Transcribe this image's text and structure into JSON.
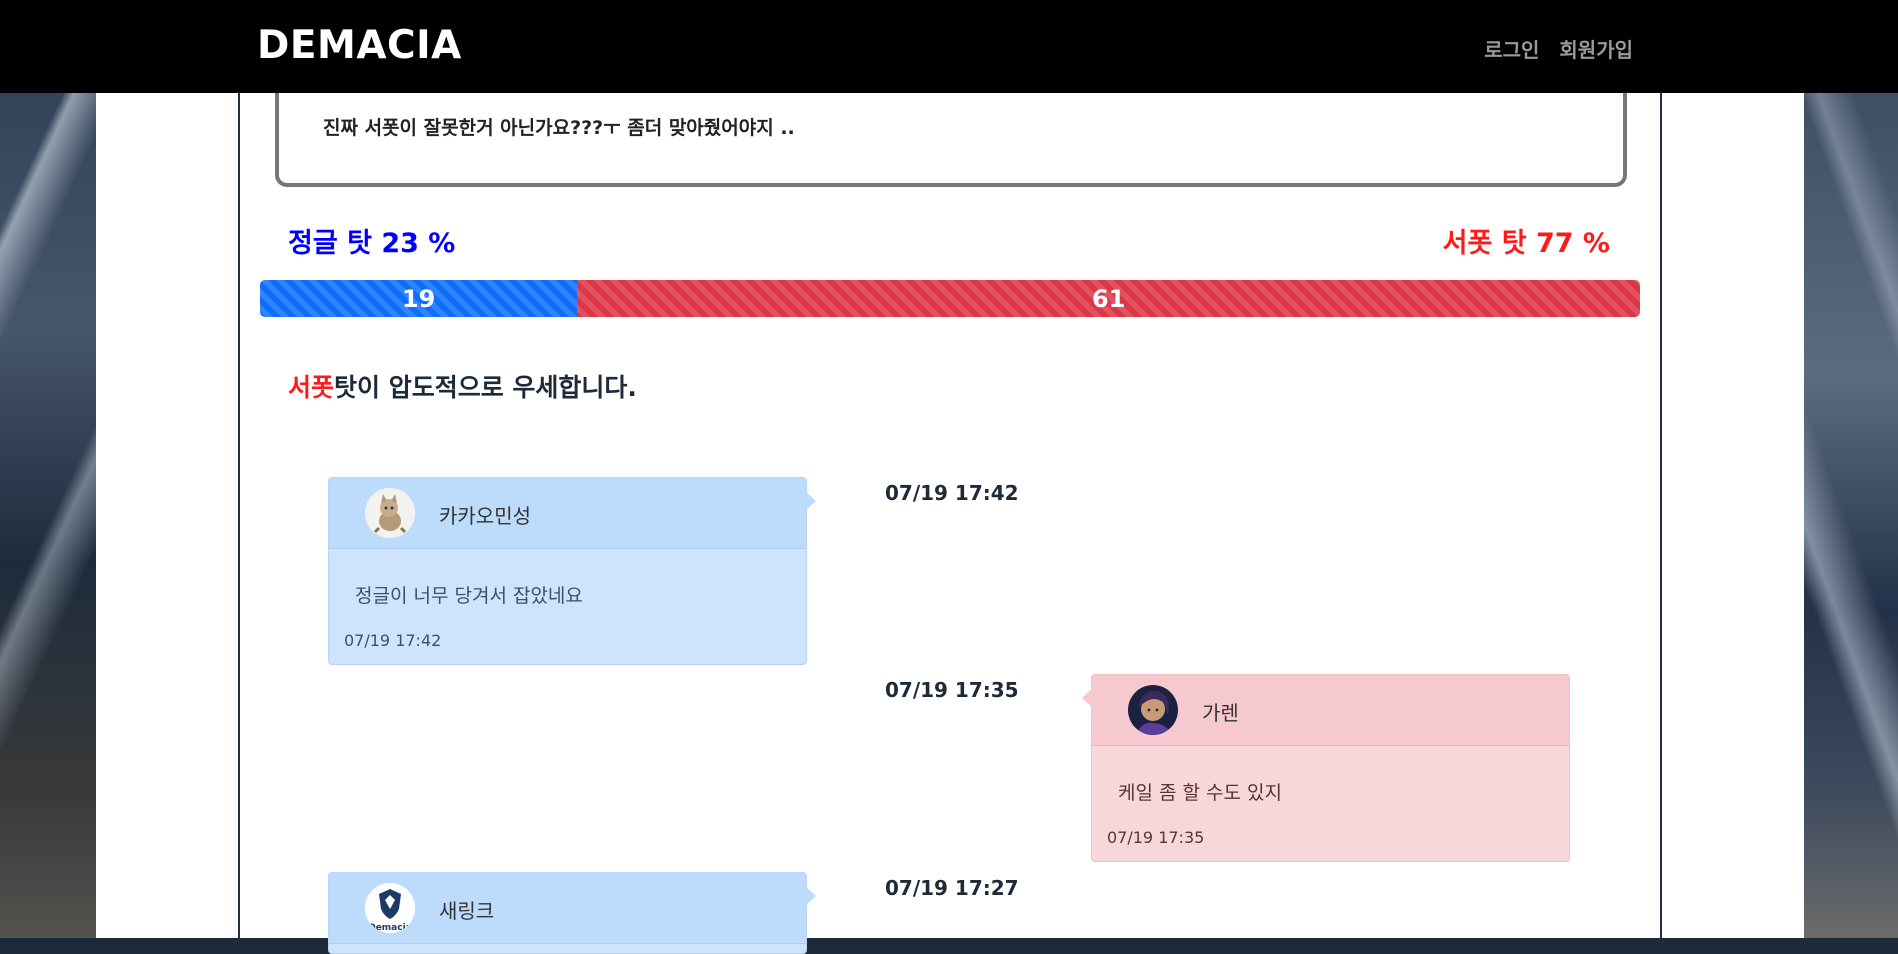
{
  "navbar": {
    "brand": "DEMACIA",
    "login": "로그인",
    "signup": "회원가입"
  },
  "post": {
    "text": "진짜 서폿이 잘못한거 아닌가요???ㅜ 좀더 맞아줬어야지 .."
  },
  "vote": {
    "left_label": "정글 탓 23 %",
    "right_label": "서폿 탓 77 %",
    "left_count": "19",
    "right_count": "61",
    "left_percent": 23,
    "right_percent": 77
  },
  "verdict": {
    "highlight": "서폿",
    "rest": "탓이 압도적으로 우세합니다."
  },
  "comments": [
    {
      "side": "jungle",
      "name": "카카오민성",
      "message": "정글이 너무 당겨서 잡았네요",
      "time": "07/19 17:42",
      "center_time": "07/19 17:42",
      "avatar": "kitten-avatar"
    },
    {
      "side": "support",
      "name": "가렌",
      "message": "케일 좀 할 수도 있지",
      "time": "07/19 17:35",
      "center_time": "07/19 17:35",
      "avatar": "champion-avatar"
    },
    {
      "side": "jungle",
      "name": "새링크",
      "message": "",
      "time": "",
      "center_time": "07/19 17:27",
      "avatar": "demacia-logo-avatar",
      "avatar_text": "Demacia"
    }
  ],
  "colors": {
    "jungle": "#0d6efd",
    "support": "#dc3545",
    "jungle_text": "#0000ff",
    "support_text": "#ff1a1a"
  }
}
